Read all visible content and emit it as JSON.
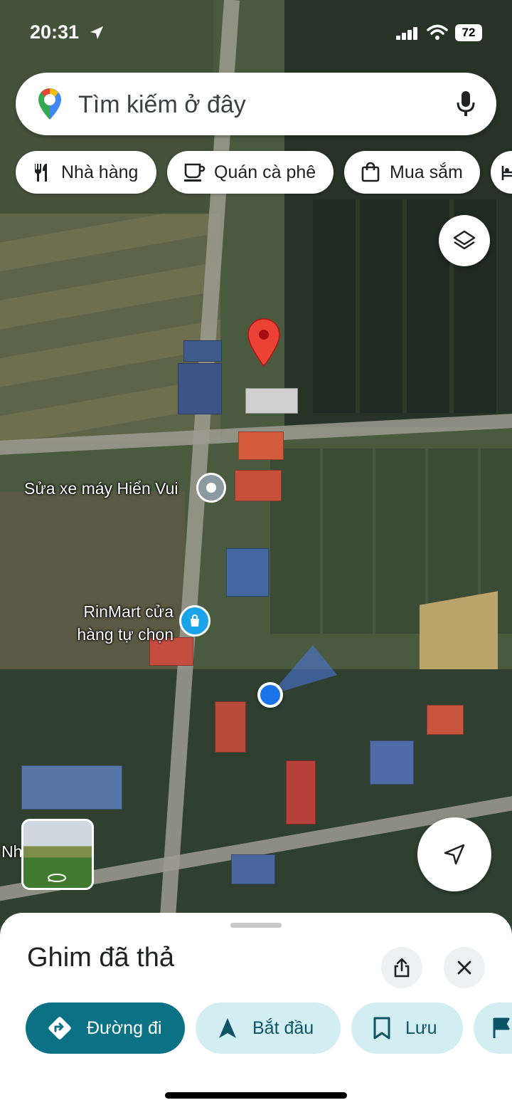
{
  "status_bar": {
    "time": "20:31",
    "battery": "72"
  },
  "search": {
    "placeholder": "Tìm kiếm ở đây"
  },
  "chips": [
    {
      "label": "Nhà hàng",
      "icon": "restaurant-icon"
    },
    {
      "label": "Quán cà phê",
      "icon": "coffee-icon"
    },
    {
      "label": "Mua sắm",
      "icon": "shopping-bag-icon"
    },
    {
      "label": "",
      "icon": "hotel-icon"
    }
  ],
  "map": {
    "pois": [
      {
        "name": "Sửa xe máy Hiển Vui",
        "icon": "place-pin-icon"
      },
      {
        "name": "RinMart cửa hàng tự chọn",
        "line1": "RinMart cửa",
        "line2": "hàng tự chọn",
        "icon": "shopping-icon"
      }
    ],
    "edge_label": "Nh",
    "dropped_pin_color": "#ea4335",
    "location_dot_color": "#1a73e8"
  },
  "sheet": {
    "title": "Ghim đã thả",
    "actions": [
      {
        "label": "Đường đi",
        "icon": "directions-icon",
        "style": "primary"
      },
      {
        "label": "Bắt đầu",
        "icon": "navigation-icon"
      },
      {
        "label": "Lưu",
        "icon": "bookmark-icon"
      },
      {
        "label": "",
        "icon": "flag-icon"
      }
    ]
  },
  "colors": {
    "primary": "#0b7285",
    "secondary": "#d3eef3",
    "secondary_text": "#0b5566"
  }
}
